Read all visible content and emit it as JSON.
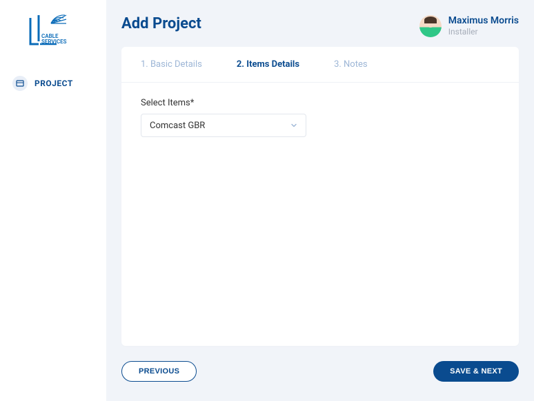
{
  "logo": {
    "text_top": "CABLE",
    "text_bottom": "SERVICES"
  },
  "sidebar": {
    "items": [
      {
        "label": "PROJECT"
      }
    ]
  },
  "header": {
    "title": "Add Project",
    "user": {
      "name": "Maximus Morris",
      "role": "Installer"
    }
  },
  "stepper": {
    "steps": [
      {
        "label": "1. Basic Details"
      },
      {
        "label": "2. Items Details"
      },
      {
        "label": "3. Notes"
      }
    ]
  },
  "form": {
    "select_items": {
      "label": "Select Items*",
      "value": "Comcast GBR"
    }
  },
  "footer": {
    "previous": "PREVIOUS",
    "save_next": "SAVE & NEXT"
  }
}
